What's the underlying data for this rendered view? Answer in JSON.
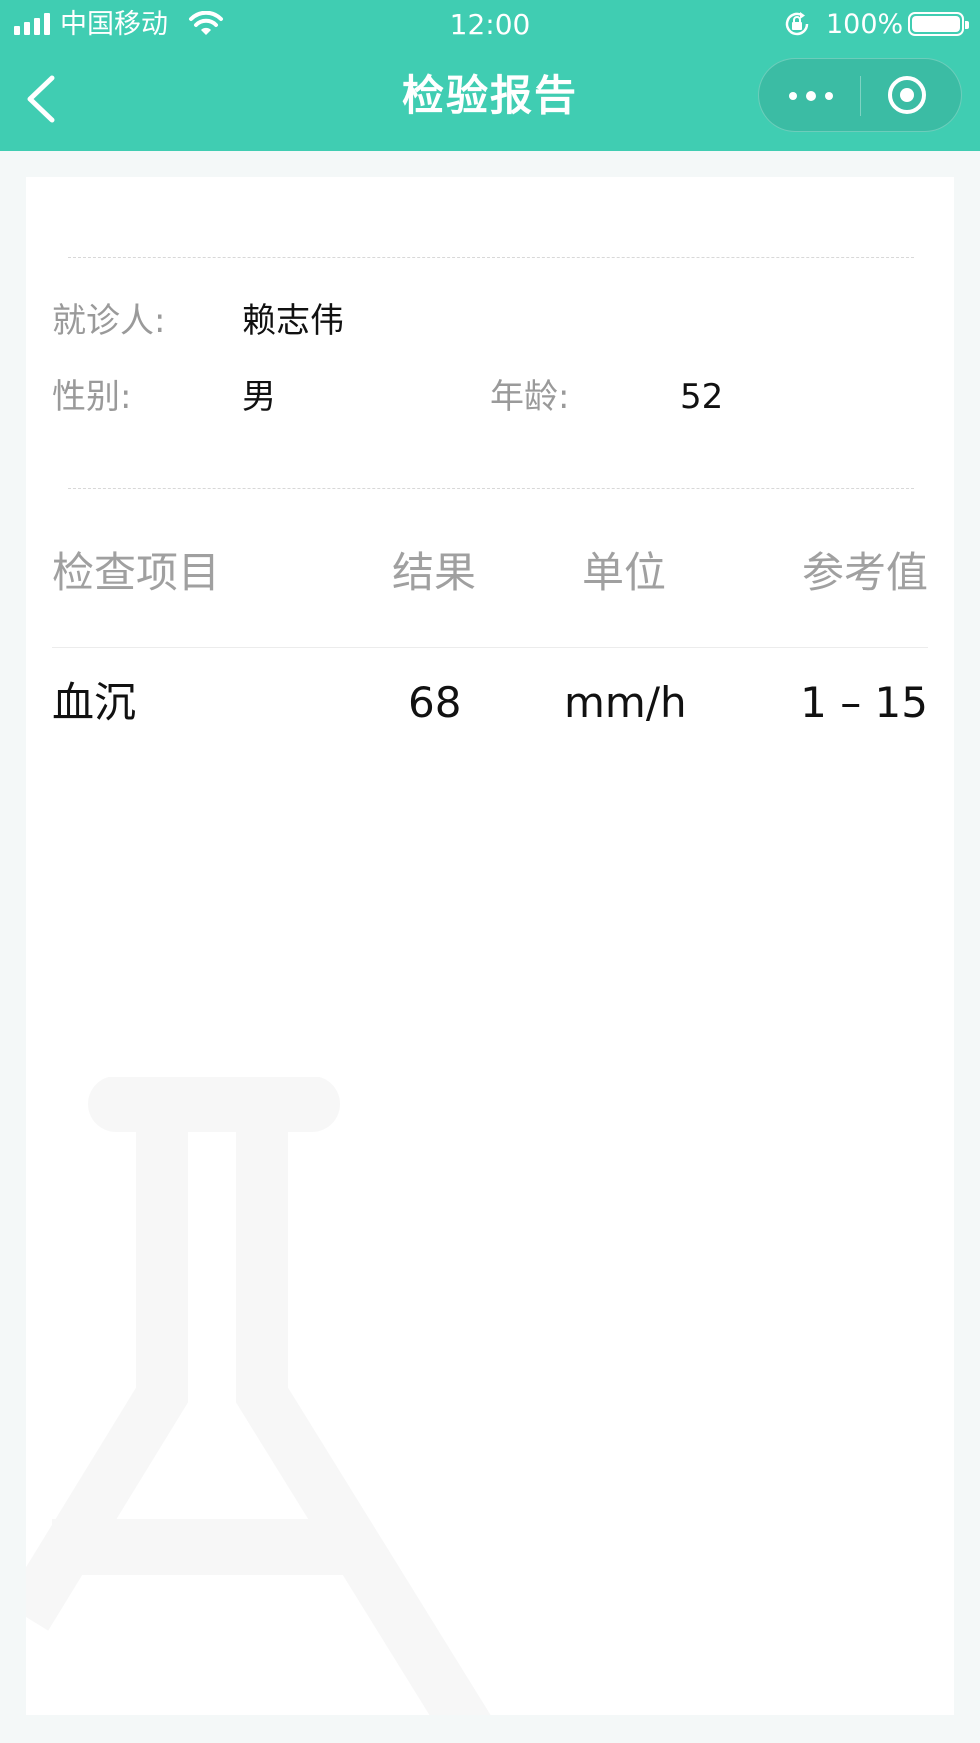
{
  "status_bar": {
    "carrier": "中国移动",
    "time": "12:00",
    "battery_percent": "100%"
  },
  "nav": {
    "title": "检验报告"
  },
  "patient": {
    "name_label": "就诊人:",
    "name_value": "赖志伟",
    "gender_label": "性别:",
    "gender_value": "男",
    "age_label": "年龄:",
    "age_value": "52"
  },
  "table": {
    "headers": [
      "检查项目",
      "结果",
      "单位",
      "参考值"
    ],
    "rows": [
      [
        "血沉",
        "68",
        "mm/h",
        "1 – 15"
      ]
    ]
  },
  "colors": {
    "accent": "#40cdb2"
  },
  "icons": [
    "back-icon",
    "more-icon",
    "target-icon",
    "flask-icon"
  ]
}
